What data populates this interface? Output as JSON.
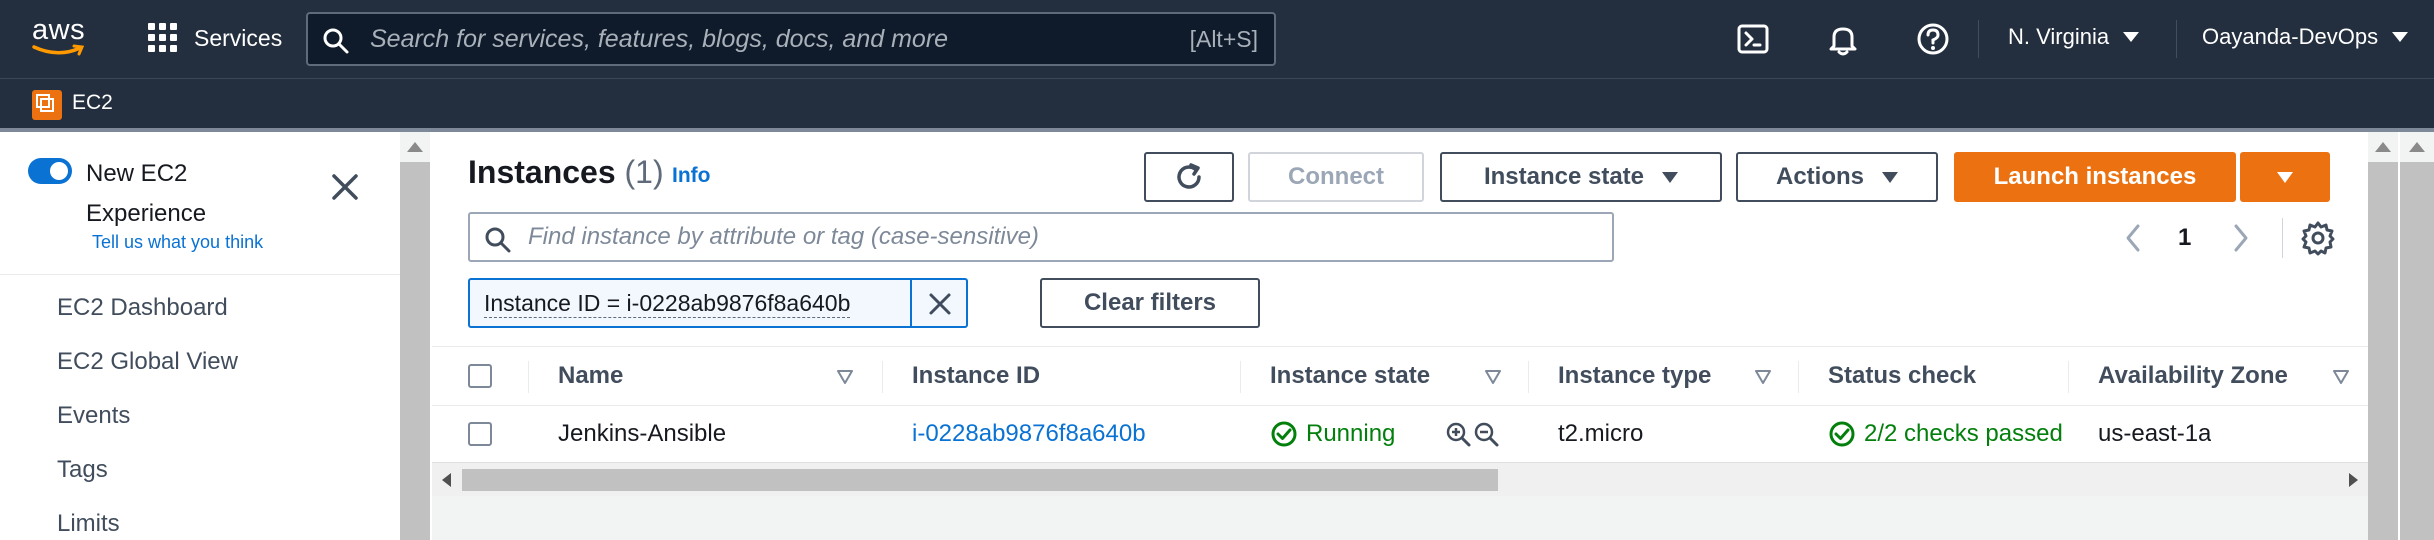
{
  "topbar": {
    "logo_text": "aws",
    "services_label": "Services",
    "search_placeholder": "Search for services, features, blogs, docs, and more",
    "search_shortcut": "[Alt+S]",
    "region": "N. Virginia",
    "account": "Oayanda-DevOps",
    "icons": [
      "grid-icon",
      "search-icon",
      "cloudshell-icon",
      "bell-icon",
      "help-icon"
    ]
  },
  "subbar": {
    "service_label": "EC2"
  },
  "leftnav": {
    "new_experience_label": "New EC2 Experience",
    "tell_us_label": "Tell us what you think",
    "items": [
      {
        "label": "EC2 Dashboard"
      },
      {
        "label": "EC2 Global View"
      },
      {
        "label": "Events"
      },
      {
        "label": "Tags"
      },
      {
        "label": "Limits"
      }
    ]
  },
  "header": {
    "title": "Instances",
    "count": "(1)",
    "info_label": "Info",
    "buttons": {
      "refresh": "refresh-icon",
      "connect": "Connect",
      "instance_state": "Instance state",
      "actions": "Actions",
      "launch": "Launch instances"
    }
  },
  "filter": {
    "placeholder": "Find instance by attribute or tag (case-sensitive)",
    "token": "Instance ID = i-0228ab9876f8a640b",
    "clear_label": "Clear filters"
  },
  "pagination": {
    "current_page": "1"
  },
  "table": {
    "columns": [
      "Name",
      "Instance ID",
      "Instance state",
      "Instance type",
      "Status check",
      "Availability Zone"
    ],
    "rows": [
      {
        "name": "Jenkins-Ansible",
        "instance_id": "i-0228ab9876f8a640b",
        "state": "Running",
        "type": "t2.micro",
        "status_check": "2/2 checks passed",
        "az": "us-east-1a"
      }
    ]
  },
  "colors": {
    "nav_bg": "#232f3e",
    "primary": "#ec7211",
    "link": "#0972d3",
    "success": "#037f0c"
  }
}
